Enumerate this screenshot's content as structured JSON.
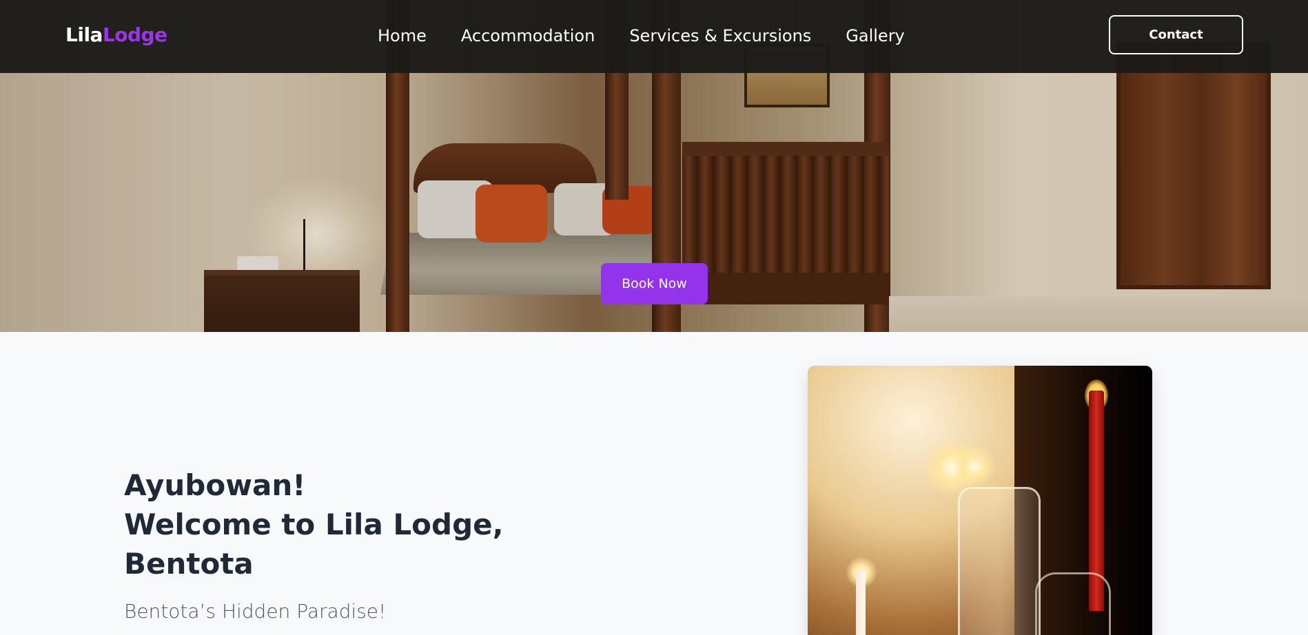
{
  "brand": {
    "logo_part1": "Lila",
    "logo_part2": "Lodge",
    "accent_color": "#9333ea"
  },
  "nav": {
    "links": [
      {
        "label": "Home"
      },
      {
        "label": "Accommodation"
      },
      {
        "label": "Services & Excursions"
      },
      {
        "label": "Gallery"
      }
    ],
    "contact_label": "Contact"
  },
  "hero": {
    "image": "bedroom-with-four-poster-bed",
    "book_label": "Book Now"
  },
  "welcome": {
    "line1": "Ayubowan!",
    "line2": "Welcome to Lila Lodge,",
    "line3": "Bentota",
    "tagline": "Bentota’s Hidden Paradise!"
  },
  "photo": {
    "image": "candlelit-table-with-glasses"
  }
}
